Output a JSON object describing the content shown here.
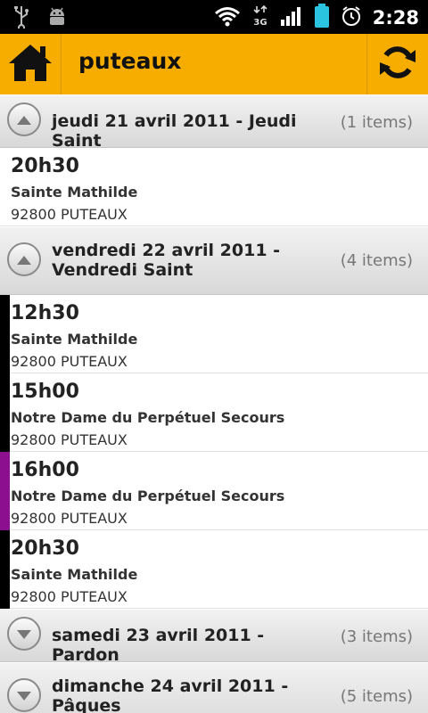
{
  "status_bar": {
    "time": "2:28",
    "network": "3G"
  },
  "header": {
    "title": "puteaux",
    "home_icon": "home-icon",
    "refresh_icon": "refresh-icon",
    "accent_color": "#f6ad00"
  },
  "groups": [
    {
      "title": "jeudi 21 avril 2011 - Jeudi Saint",
      "count": "(1 items)",
      "expanded": true,
      "items": [
        {
          "time": "20h30",
          "place": "Sainte Mathilde",
          "city": "92800 PUTEAUX",
          "bar_color": ""
        }
      ]
    },
    {
      "title": "vendredi 22 avril 2011 - Vendredi Saint",
      "count": "(4 items)",
      "expanded": true,
      "items": [
        {
          "time": "12h30",
          "place": "Sainte Mathilde",
          "city": "92800 PUTEAUX",
          "bar_color": "#000000"
        },
        {
          "time": "15h00",
          "place": "Notre Dame du Perpétuel Secours",
          "city": "92800 PUTEAUX",
          "bar_color": "#000000"
        },
        {
          "time": "16h00",
          "place": "Notre Dame du Perpétuel Secours",
          "city": "92800 PUTEAUX",
          "bar_color": "#8b0f8e"
        },
        {
          "time": "20h30",
          "place": "Sainte Mathilde",
          "city": "92800 PUTEAUX",
          "bar_color": "#000000"
        }
      ]
    },
    {
      "title": "samedi 23 avril 2011 - Pardon",
      "count": "(3 items)",
      "expanded": false,
      "items": []
    },
    {
      "title": "dimanche 24 avril 2011 - Pâques",
      "count": "(5 items)",
      "expanded": false,
      "items": []
    }
  ]
}
